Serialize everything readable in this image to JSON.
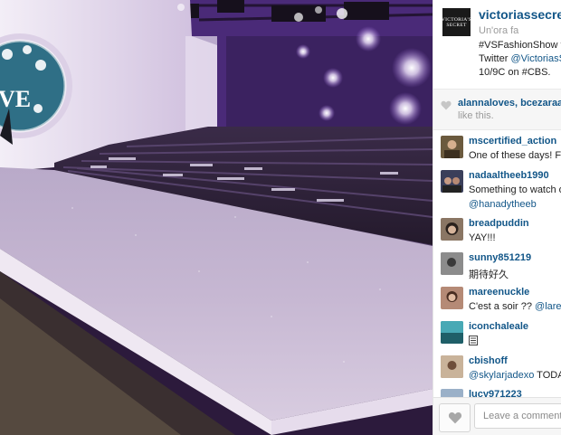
{
  "post": {
    "logo_text": "VICTORIA'S SECRET",
    "username": "victoriassecret",
    "location": "Un'ora fa",
    "caption": {
      "line1": "#VSFashionShow ta",
      "line2_prefix": "Twitter ",
      "line2_link": "@VictoriasSe",
      "line3": "10/9C on #CBS."
    }
  },
  "likes": {
    "icon": "heart-icon",
    "names": "alannaloves, bcezaraaa",
    "suffix": "like this."
  },
  "comments": [
    {
      "user": "mscertified_action",
      "text": "One of these days! Fe",
      "mention": "",
      "avatar_color": "#6b5a3e"
    },
    {
      "user": "nadaaltheeb1990",
      "text": "Something to watch o",
      "mention": "",
      "avatar_color": "#3a3f5a"
    },
    {
      "user": "",
      "text": "",
      "mention": "@hanadytheeb",
      "avatar_color": ""
    },
    {
      "user": "breadpuddin",
      "text": "YAY!!!",
      "mention": "",
      "avatar_color": "#8a7664"
    },
    {
      "user": "sunny851219",
      "text": "期待好久",
      "mention": "",
      "avatar_color": "#6a6a6a"
    },
    {
      "user": "mareenuckle",
      "text": "C'est a soir ?? ",
      "mention": "@larend",
      "avatar_color": "#b58a76"
    },
    {
      "user": "iconchaleale",
      "text": "",
      "mention": "",
      "avatar_color": "#2f7f8a"
    },
    {
      "user": "cbishoff",
      "text": "",
      "mention": "@skylarjadexo",
      "text_after": " TODAY",
      "avatar_color": "#a38872"
    },
    {
      "user": "lucy971223",
      "text": "",
      "mention": "",
      "avatar_color": "#9ab0c8"
    }
  ],
  "footer": {
    "like_icon": "heart-icon",
    "comment_placeholder": "Leave a comment..."
  },
  "photo": {
    "sign_text": "VE"
  }
}
